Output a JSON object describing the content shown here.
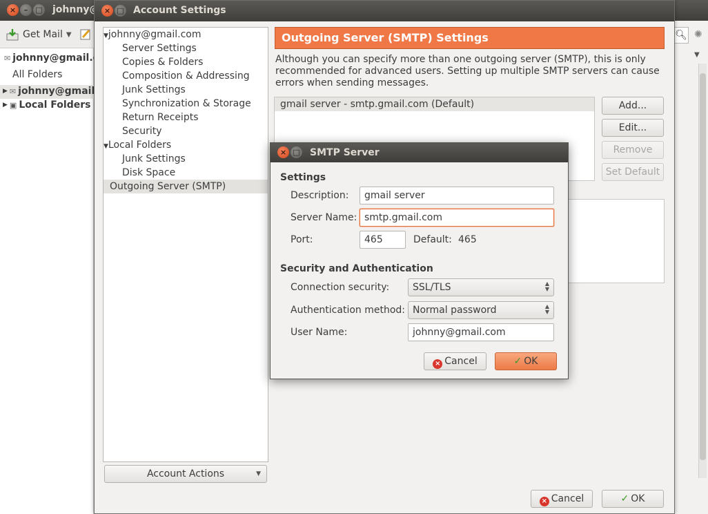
{
  "main_window": {
    "title": "johnny@",
    "toolbar": {
      "get_mail": "Get Mail"
    },
    "folders": {
      "header": "johnny@gmail.c",
      "all_folders": "All Folders",
      "items": [
        "johnny@gmail.",
        "Local Folders"
      ]
    }
  },
  "account_settings": {
    "title": "Account Settings",
    "tree": [
      "johnny@gmail.com",
      "Server Settings",
      "Copies & Folders",
      "Composition & Addressing",
      "Junk Settings",
      "Synchronization & Storage",
      "Return Receipts",
      "Security",
      "Local Folders",
      "Junk Settings",
      "Disk Space",
      "Outgoing Server (SMTP)"
    ],
    "account_actions": "Account Actions",
    "smtp_header": "Outgoing Server (SMTP) Settings",
    "smtp_description": "Although you can specify more than one outgoing server (SMTP), this is only recommended for advanced users. Setting up multiple SMTP servers can cause errors when sending messages.",
    "server_list": [
      "gmail server - smtp.gmail.com (Default)"
    ],
    "buttons": {
      "add": "Add...",
      "edit": "Edit...",
      "remove": "Remove",
      "set_default": "Set Default",
      "cancel": "Cancel",
      "ok": "OK"
    }
  },
  "smtp_dialog": {
    "title": "SMTP Server",
    "settings_heading": "Settings",
    "description_label": "Description:",
    "description_value": "gmail server",
    "server_name_label": "Server Name:",
    "server_name_value": "smtp.gmail.com",
    "port_label": "Port:",
    "port_value": "465",
    "default_label": "Default:",
    "default_value": "465",
    "security_heading": "Security and Authentication",
    "connection_security_label": "Connection security:",
    "connection_security_value": "SSL/TLS",
    "auth_method_label": "Authentication method:",
    "auth_method_value": "Normal password",
    "user_name_label": "User Name:",
    "user_name_value": "johnny@gmail.com",
    "cancel": "Cancel",
    "ok": "OK"
  },
  "colors": {
    "accent": "#f07746",
    "titlebar": "#3f3e3b"
  }
}
